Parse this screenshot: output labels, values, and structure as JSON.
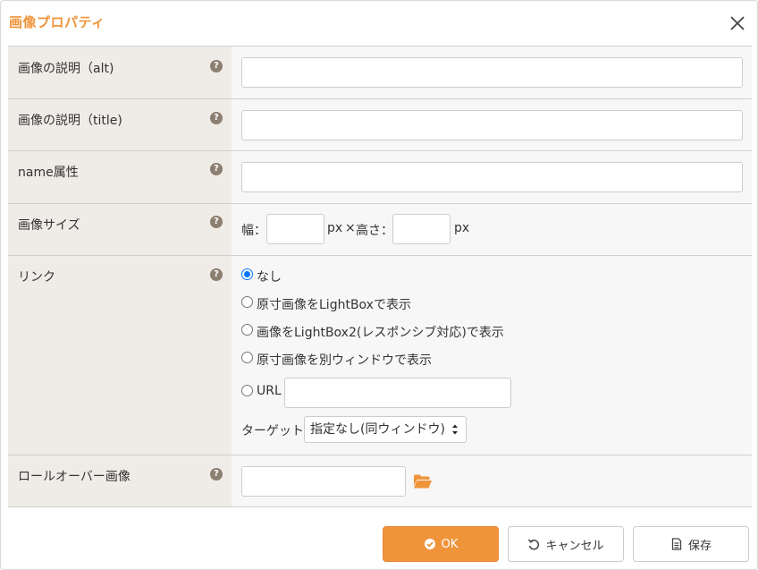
{
  "dialog": {
    "title": "画像プロパティ",
    "close_icon": "close-icon",
    "accent_color": "#f0943a"
  },
  "fields": {
    "alt": {
      "label": "画像の説明（alt)",
      "value": ""
    },
    "title": {
      "label": "画像の説明（title)",
      "value": ""
    },
    "name": {
      "label": "name属性",
      "value": ""
    },
    "size": {
      "label": "画像サイズ",
      "width_label": "幅：",
      "width_value": "",
      "unit_1": "px",
      "times": "×",
      "height_label": "高さ：",
      "height_value": "",
      "unit_2": "px"
    },
    "link": {
      "label": "リンク",
      "options": [
        {
          "label": "なし",
          "checked": true
        },
        {
          "label": "原寸画像をLightBoxで表示",
          "checked": false
        },
        {
          "label": "画像をLightBox2(レスポンシブ対応)で表示",
          "checked": false
        },
        {
          "label": "原寸画像を別ウィンドウで表示",
          "checked": false
        },
        {
          "label": "URL",
          "checked": false
        }
      ],
      "url_value": "",
      "target_label": "ターゲット",
      "target_selected": "指定なし(同ウィンドウ)"
    },
    "rollover": {
      "label": "ロールオーバー画像",
      "value": "",
      "folder_icon": "folder-open-icon"
    }
  },
  "help_glyph": "?",
  "footer": {
    "ok_label": "OK",
    "cancel_label": "キャンセル",
    "save_label": "保存"
  }
}
